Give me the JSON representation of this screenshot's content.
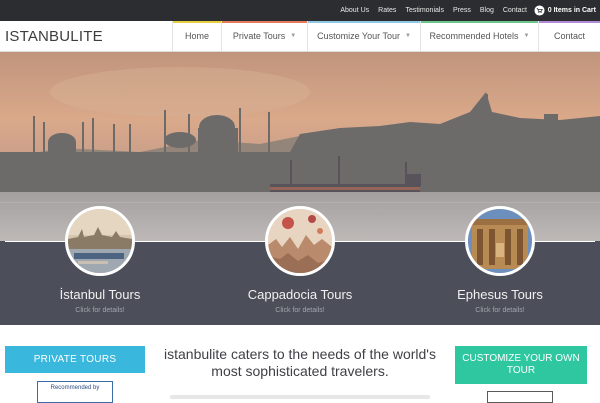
{
  "topbar": {
    "links": [
      "About Us",
      "Rates",
      "Testimonials",
      "Press",
      "Blog",
      "Contact"
    ],
    "cart": "0 Items in Cart"
  },
  "brand": {
    "logo": "ISTANBULITE"
  },
  "nav": {
    "items": [
      {
        "label": "Home",
        "accent": "#e5cf3f",
        "dropdown": false
      },
      {
        "label": "Private Tours",
        "accent": "#e57b5c",
        "dropdown": true
      },
      {
        "label": "Customize Your Tour",
        "accent": "#8fc8e4",
        "dropdown": true
      },
      {
        "label": "Recommended Hotels",
        "accent": "#6cc58b",
        "dropdown": true
      },
      {
        "label": "Contact",
        "accent": "#b08ad4",
        "dropdown": false
      }
    ]
  },
  "tours": [
    {
      "title": "İstanbul Tours",
      "subtitle": "Click for details!"
    },
    {
      "title": "Cappadocia Tours",
      "subtitle": "Click for details!"
    },
    {
      "title": "Ephesus Tours",
      "subtitle": "Click for details!"
    }
  ],
  "bottom": {
    "private_button": "PRIVATE TOURS",
    "tagline": "istanbulite caters to the needs of the world's most sophisticated travelers.",
    "custom_button": "CUSTOMIZE YOUR OWN TOUR",
    "badge_text": "Recommended by"
  },
  "colors": {
    "topbar": "#2b2d30",
    "tiles": "#4c4f59",
    "private_button": "#3ab7dd",
    "custom_button": "#2ec7a0"
  }
}
